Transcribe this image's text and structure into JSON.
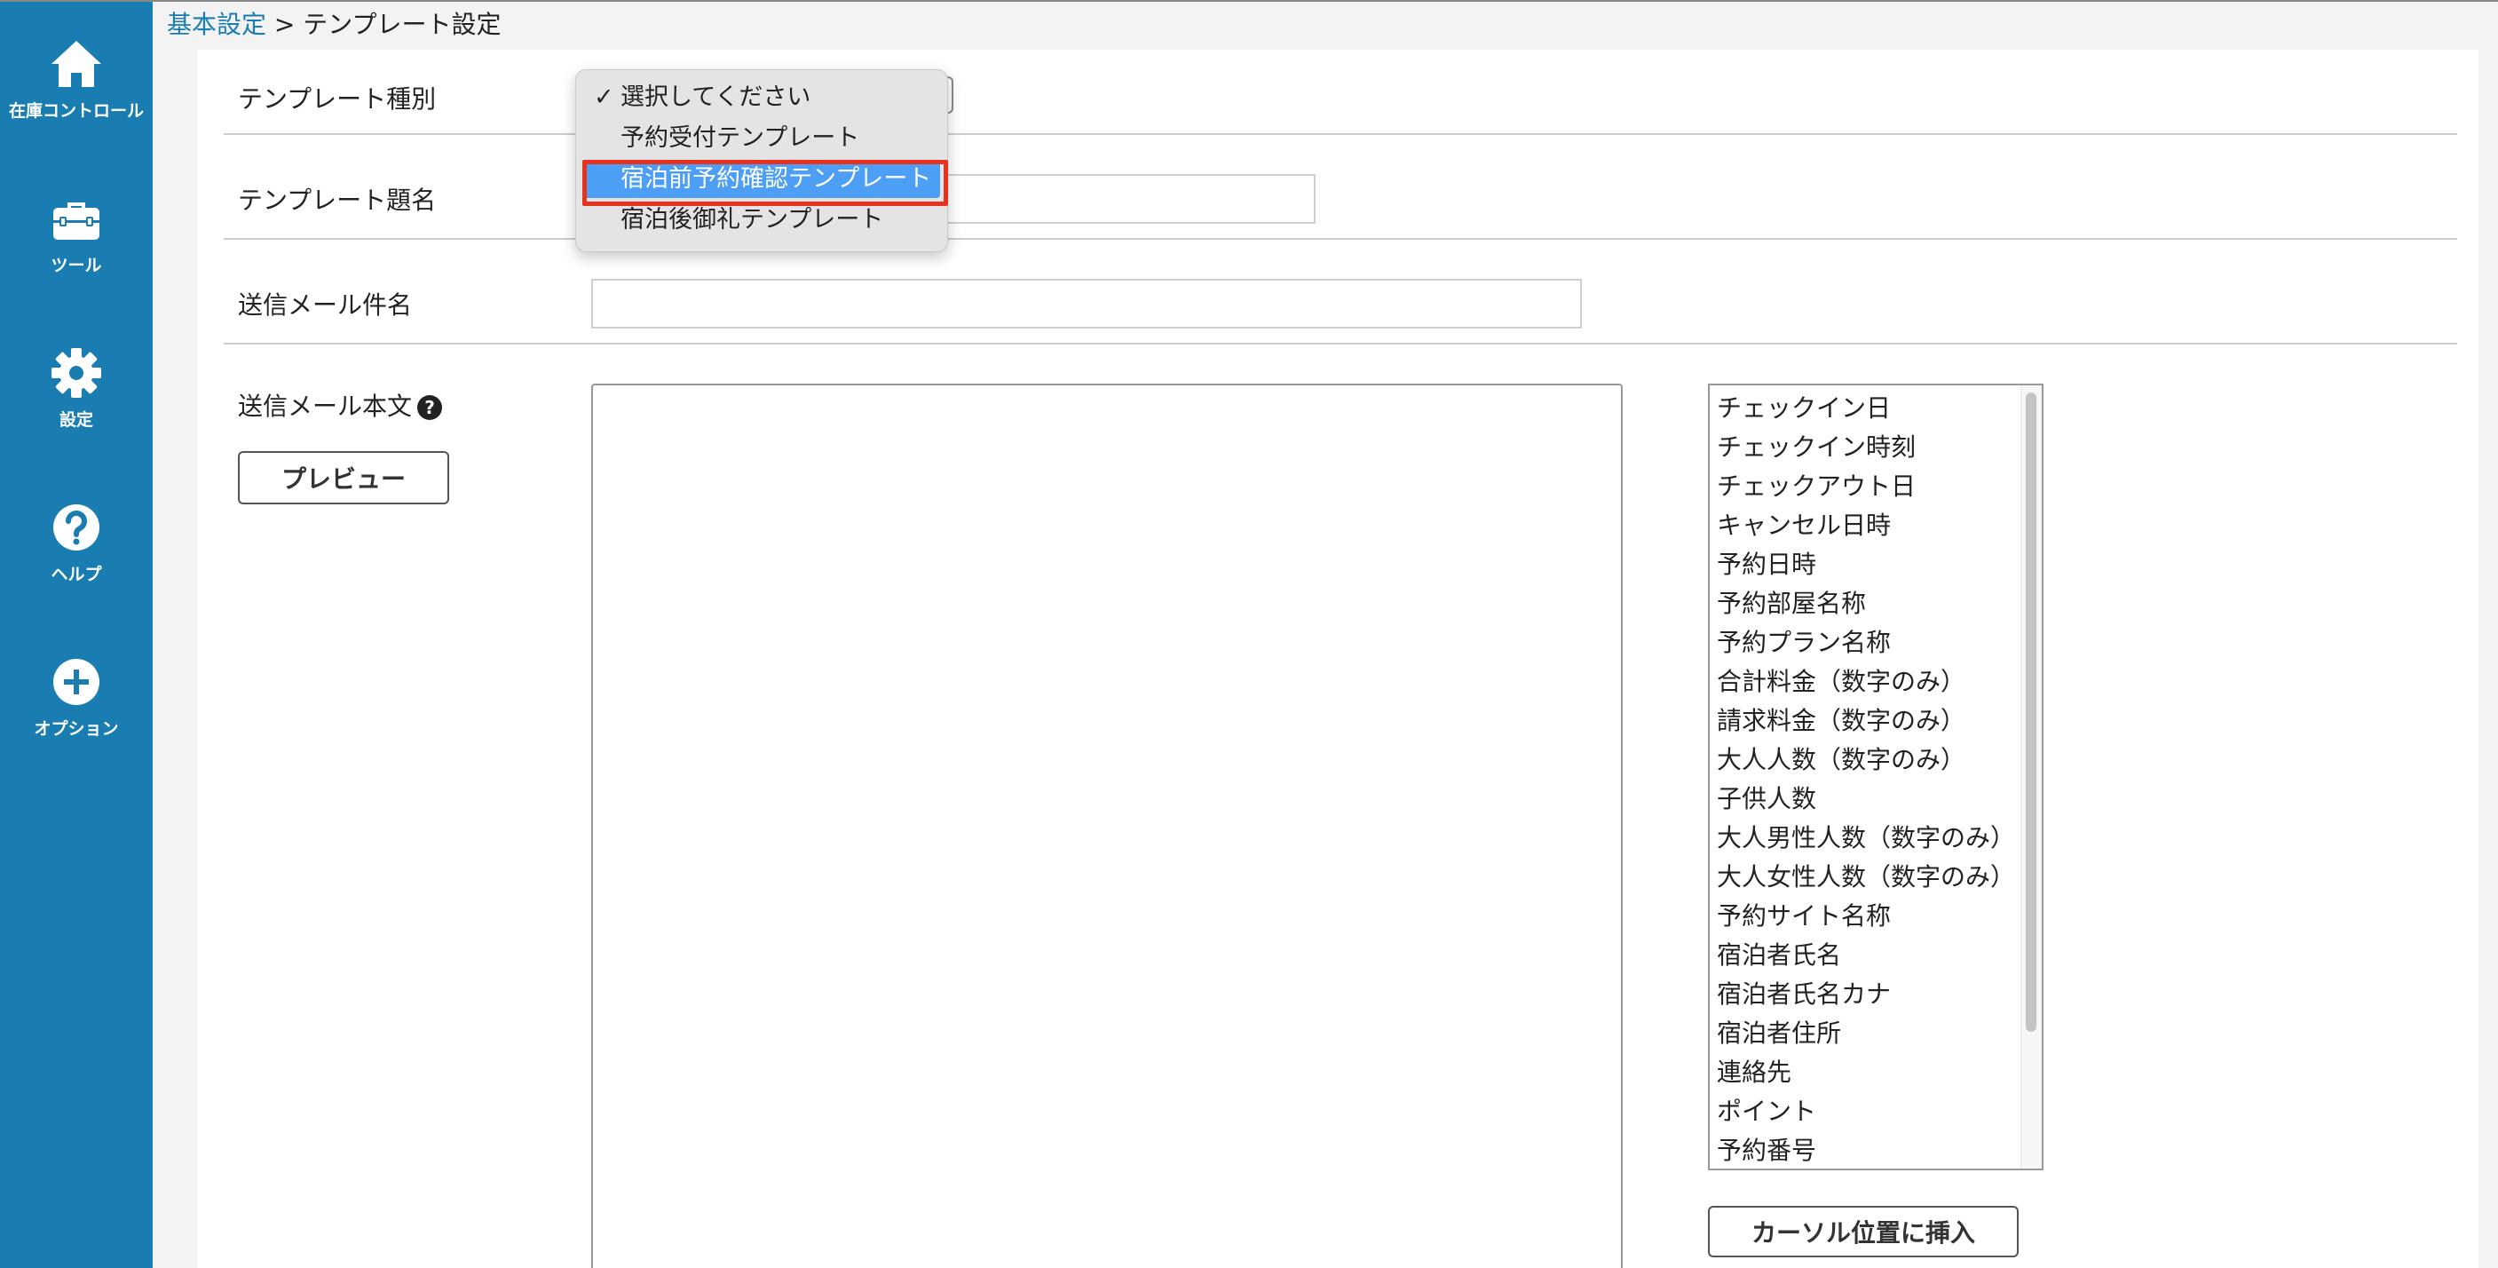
{
  "sidebar": {
    "items": [
      {
        "label": "在庫コントロール",
        "icon": "home-icon"
      },
      {
        "label": "ツール",
        "icon": "toolbox-icon"
      },
      {
        "label": "設定",
        "icon": "gear-icon"
      },
      {
        "label": "ヘルプ",
        "icon": "help-circle-icon"
      },
      {
        "label": "オプション",
        "icon": "plus-circle-icon"
      }
    ]
  },
  "breadcrumb": {
    "parent": "基本設定",
    "separator": " > ",
    "current": "テンプレート設定"
  },
  "form": {
    "template_type_label": "テンプレート種別",
    "template_title_label": "テンプレート題名",
    "template_title_value": "",
    "subject_label": "送信メール件名",
    "subject_value": "",
    "body_label": "送信メール本文",
    "body_help_icon": "?",
    "preview_button": "プレビュー",
    "insert_button": "カーソル位置に挿入"
  },
  "dropdown": {
    "checkmark": "✓",
    "options": [
      "選択してください",
      "予約受付テンプレート",
      "宿泊前予約確認テンプレート",
      "宿泊後御礼テンプレート"
    ],
    "checked_index": 0,
    "highlighted_index": 2
  },
  "variables": [
    "チェックイン日",
    "チェックイン時刻",
    "チェックアウト日",
    "キャンセル日時",
    "予約日時",
    "予約部屋名称",
    "予約プラン名称",
    "合計料金（数字のみ）",
    "請求料金（数字のみ）",
    "大人人数（数字のみ）",
    "子供人数",
    "大人男性人数（数字のみ）",
    "大人女性人数（数字のみ）",
    "予約サイト名称",
    "宿泊者氏名",
    "宿泊者氏名カナ",
    "宿泊者住所",
    "連絡先",
    "ポイント",
    "予約番号"
  ],
  "colors": {
    "sidebar": "#1a7db2",
    "link": "#1a7db2",
    "selected_option": "#4d9ef5",
    "annotation_box": "#e8321d"
  }
}
